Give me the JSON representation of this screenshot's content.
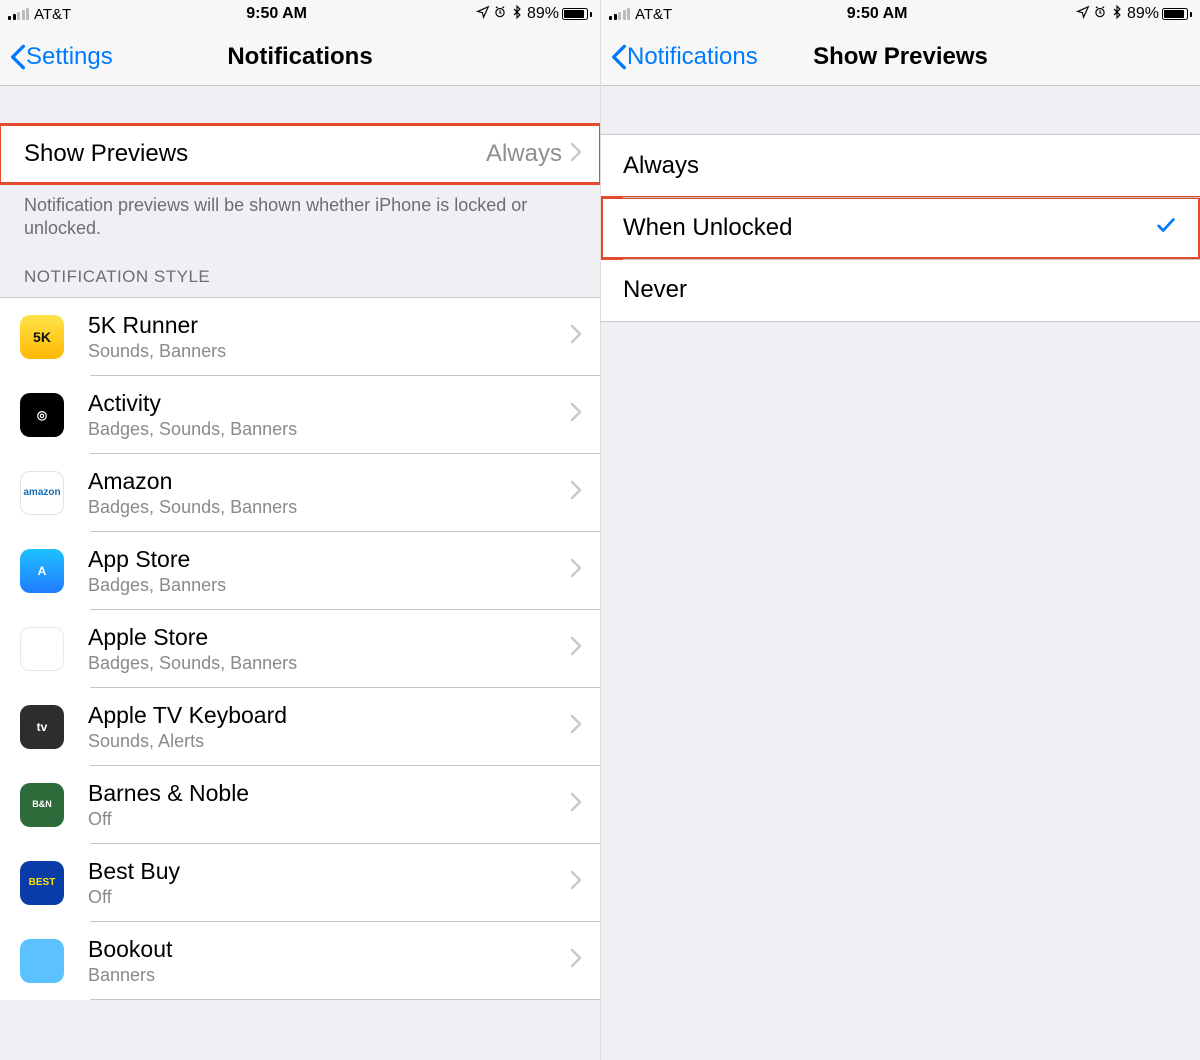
{
  "status": {
    "carrier": "AT&T",
    "time": "9:50 AM",
    "battery_pct": "89%",
    "battery_fill": 89
  },
  "left": {
    "back_label": "Settings",
    "title": "Notifications",
    "show_previews": {
      "label": "Show Previews",
      "value": "Always"
    },
    "footer": "Notification previews will be shown whether iPhone is locked or unlocked.",
    "section_header": "NOTIFICATION STYLE",
    "apps": [
      {
        "name": "5K Runner",
        "sub": "Sounds, Banners",
        "icon": "ic-5k",
        "abbr": "5K"
      },
      {
        "name": "Activity",
        "sub": "Badges, Sounds, Banners",
        "icon": "ic-activity",
        "abbr": "◎"
      },
      {
        "name": "Amazon",
        "sub": "Badges, Sounds, Banners",
        "icon": "ic-amazon",
        "abbr": "amazon"
      },
      {
        "name": "App Store",
        "sub": "Badges, Banners",
        "icon": "ic-appstore",
        "abbr": "A"
      },
      {
        "name": "Apple Store",
        "sub": "Badges, Sounds, Banners",
        "icon": "ic-applestore",
        "abbr": ""
      },
      {
        "name": "Apple TV Keyboard",
        "sub": "Sounds, Alerts",
        "icon": "ic-tvkb",
        "abbr": "tv"
      },
      {
        "name": "Barnes & Noble",
        "sub": "Off",
        "icon": "ic-bn",
        "abbr": "B&N"
      },
      {
        "name": "Best Buy",
        "sub": "Off",
        "icon": "ic-bestbuy",
        "abbr": "BEST"
      },
      {
        "name": "Bookout",
        "sub": "Banners",
        "icon": "ic-bookout",
        "abbr": ""
      }
    ]
  },
  "right": {
    "back_label": "Notifications",
    "title": "Show Previews",
    "options": [
      {
        "label": "Always",
        "selected": false,
        "hl": false
      },
      {
        "label": "When Unlocked",
        "selected": true,
        "hl": true
      },
      {
        "label": "Never",
        "selected": false,
        "hl": false
      }
    ]
  }
}
